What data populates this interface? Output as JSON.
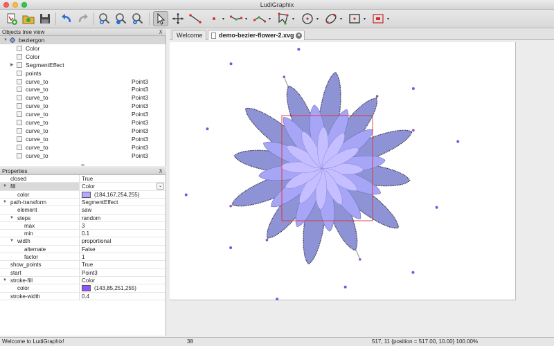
{
  "window": {
    "title": "LudiGraphix"
  },
  "toolbar": {
    "buttons": [
      "new-document-icon",
      "open-folder-icon",
      "save-icon",
      "undo-icon",
      "redo-icon",
      "zoom-in-icon",
      "zoom-reset-icon",
      "zoom-out-icon",
      "select-arrow-icon",
      "move-icon",
      "line-tool-icon",
      "point-tool-icon",
      "polyline-tool-icon",
      "path-tool-icon",
      "polygon-tool-icon",
      "circle-tool-icon",
      "ellipse-tool-icon",
      "rectangle-tool-icon",
      "frame-tool-icon"
    ]
  },
  "tree_panel": {
    "title": "Objects tree view",
    "rows": [
      {
        "label": "beziergon",
        "type": "",
        "level": 0,
        "arrow": "▼",
        "selected": true,
        "icon": "diamond"
      },
      {
        "label": "Color",
        "type": "",
        "level": 1,
        "arrow": "",
        "selected": false
      },
      {
        "label": "Color",
        "type": "",
        "level": 1,
        "arrow": "",
        "selected": false
      },
      {
        "label": "SegmentEffect",
        "type": "",
        "level": 1,
        "arrow": "▶",
        "selected": false
      },
      {
        "label": "points",
        "type": "",
        "level": 1,
        "arrow": "",
        "selected": false
      },
      {
        "label": "curve_to",
        "type": "Point3",
        "level": 1,
        "arrow": "",
        "selected": false
      },
      {
        "label": "curve_to",
        "type": "Point3",
        "level": 1,
        "arrow": "",
        "selected": false
      },
      {
        "label": "curve_to",
        "type": "Point3",
        "level": 1,
        "arrow": "",
        "selected": false
      },
      {
        "label": "curve_to",
        "type": "Point3",
        "level": 1,
        "arrow": "",
        "selected": false
      },
      {
        "label": "curve_to",
        "type": "Point3",
        "level": 1,
        "arrow": "",
        "selected": false
      },
      {
        "label": "curve_to",
        "type": "Point3",
        "level": 1,
        "arrow": "",
        "selected": false
      },
      {
        "label": "curve_to",
        "type": "Point3",
        "level": 1,
        "arrow": "",
        "selected": false
      },
      {
        "label": "curve_to",
        "type": "Point3",
        "level": 1,
        "arrow": "",
        "selected": false
      },
      {
        "label": "curve_to",
        "type": "Point3",
        "level": 1,
        "arrow": "",
        "selected": false
      },
      {
        "label": "curve_to",
        "type": "Point3",
        "level": 1,
        "arrow": "",
        "selected": false
      }
    ]
  },
  "props_panel": {
    "title": "Properties",
    "rows": [
      {
        "key": "closed",
        "value": "True",
        "indent": 1,
        "arrow": ""
      },
      {
        "key": "fill",
        "value": "Color",
        "indent": 1,
        "arrow": "▼",
        "highlight": true,
        "combo": true
      },
      {
        "key": "color",
        "value": "(184,167,254,255)",
        "indent": 2,
        "arrow": "",
        "swatch": "#b8a7fe"
      },
      {
        "key": "path-transform",
        "value": "SegmentEffect",
        "indent": 1,
        "arrow": "▼"
      },
      {
        "key": "element",
        "value": "saw",
        "indent": 2,
        "arrow": ""
      },
      {
        "key": "steps",
        "value": "random",
        "indent": 2,
        "arrow": "▼"
      },
      {
        "key": "max",
        "value": "3",
        "indent": 3,
        "arrow": ""
      },
      {
        "key": "min",
        "value": "0.1",
        "indent": 3,
        "arrow": ""
      },
      {
        "key": "width",
        "value": "proportional",
        "indent": 2,
        "arrow": "▼"
      },
      {
        "key": "alternate",
        "value": "False",
        "indent": 3,
        "arrow": ""
      },
      {
        "key": "factor",
        "value": "1",
        "indent": 3,
        "arrow": ""
      },
      {
        "key": "show_points",
        "value": "True",
        "indent": 1,
        "arrow": ""
      },
      {
        "key": "start",
        "value": "Point3",
        "indent": 1,
        "arrow": ""
      },
      {
        "key": "stroke-fill",
        "value": "Color",
        "indent": 1,
        "arrow": "▼"
      },
      {
        "key": "color",
        "value": "(143,85,251,255)",
        "indent": 2,
        "arrow": "",
        "swatch": "#8f55fb"
      },
      {
        "key": "stroke-width",
        "value": "0.4",
        "indent": 1,
        "arrow": ""
      }
    ]
  },
  "tabs": [
    {
      "label": "Welcome",
      "active": false
    },
    {
      "label": "demo-bezier-flower-2.xvg",
      "active": true
    }
  ],
  "canvas": {
    "colors": {
      "outer": "#8e93d6",
      "mid": "#a7a5f5",
      "inner": "#c6bfff",
      "stroke": "#3a3a55",
      "selection": "#e03030",
      "point_blue": "#5a64e0",
      "point_purple": "#9050c0"
    }
  },
  "status": {
    "message": "Welcome to LudiGraphix!",
    "count": "38",
    "position": "517, 11  {position = 517.00, 10.00}  100.00%"
  }
}
